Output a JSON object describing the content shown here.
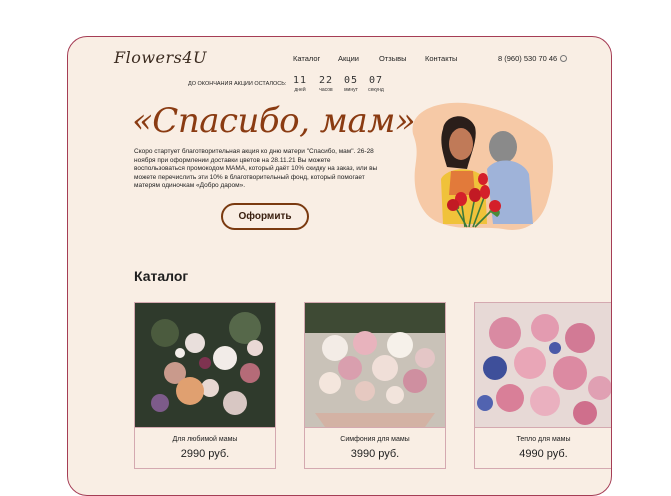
{
  "header": {
    "logo": "Flowers4U",
    "nav": [
      "Каталог",
      "Акции",
      "Отзывы",
      "Контакты"
    ],
    "phone": "8 (960) 530 70 46"
  },
  "countdown": {
    "label": "ДО ОКОНЧАНИЯ АКЦИИ ОСТАЛОСЬ:",
    "items": [
      {
        "value": "11",
        "unit": "дней"
      },
      {
        "value": "22",
        "unit": "часов"
      },
      {
        "value": "05",
        "unit": "минут"
      },
      {
        "value": "07",
        "unit": "секунд"
      }
    ]
  },
  "hero": {
    "title": "«Спасибо, мам»",
    "description": "Скоро стартует благотворительная акция ко дню матери \"Спасибо, мам\". 26-28 ноября при оформлении доставки цветов на 28.11.21 Вы можете воспользоваться промокодом МАМА, который даёт 10% скидку на заказ, или вы можете перечислить эти 10% в благотворительный фонд, который помогает матерям одиночкам «Добро даром».",
    "cta": "Оформить"
  },
  "catalog": {
    "title": "Каталог",
    "items": [
      {
        "name": "Для любимой мамы",
        "price": "2990 руб."
      },
      {
        "name": "Симфония для мамы",
        "price": "3990 руб."
      },
      {
        "name": "Тепло для мамы",
        "price": "4990 руб."
      }
    ]
  },
  "colors": {
    "background": "#f9eee4",
    "accent": "#8a3b12",
    "frame_border": "#a53d55",
    "card_border": "#d4a9b0"
  }
}
